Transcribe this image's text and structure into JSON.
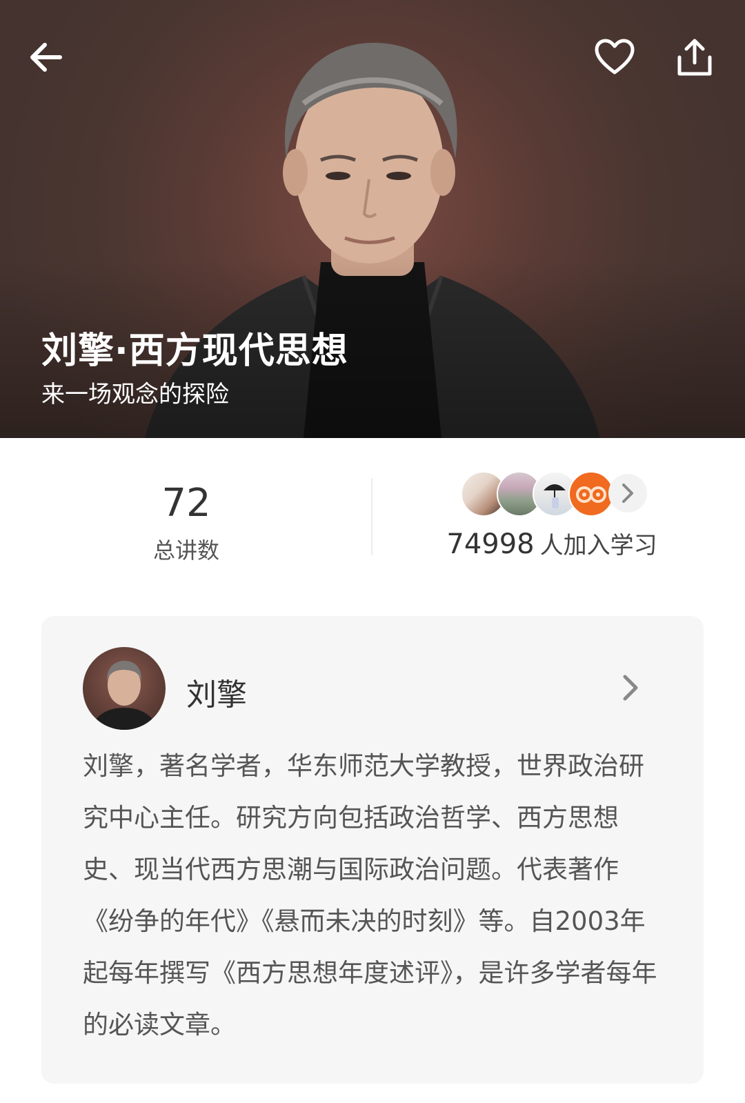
{
  "header": {
    "title": "刘擎·西方现代思想",
    "subtitle": "来一场观念的探险"
  },
  "icons": {
    "back": "arrow-left-icon",
    "favorite": "heart-icon",
    "share": "share-icon",
    "more": "chevron-right-icon"
  },
  "stats": {
    "lessons": {
      "value": "72",
      "label": "总讲数"
    },
    "learners": {
      "count": "74998",
      "suffix": "人加入学习"
    }
  },
  "author": {
    "name": "刘擎",
    "bio": "刘擎，著名学者，华东师范大学教授，世界政治研究中心主任。研究方向包括政治哲学、西方思想史、现当代西方思潮与国际政治问题。代表著作《纷争的年代》《悬而未决的时刻》等。自2003年起每年撰写《西方思想年度述评》，是许多学者每年的必读文章。"
  },
  "colors": {
    "hero_background": "#4a3631",
    "accent_orange": "#f06a1f",
    "card_background": "#f6f6f6",
    "text_primary": "#333333"
  }
}
